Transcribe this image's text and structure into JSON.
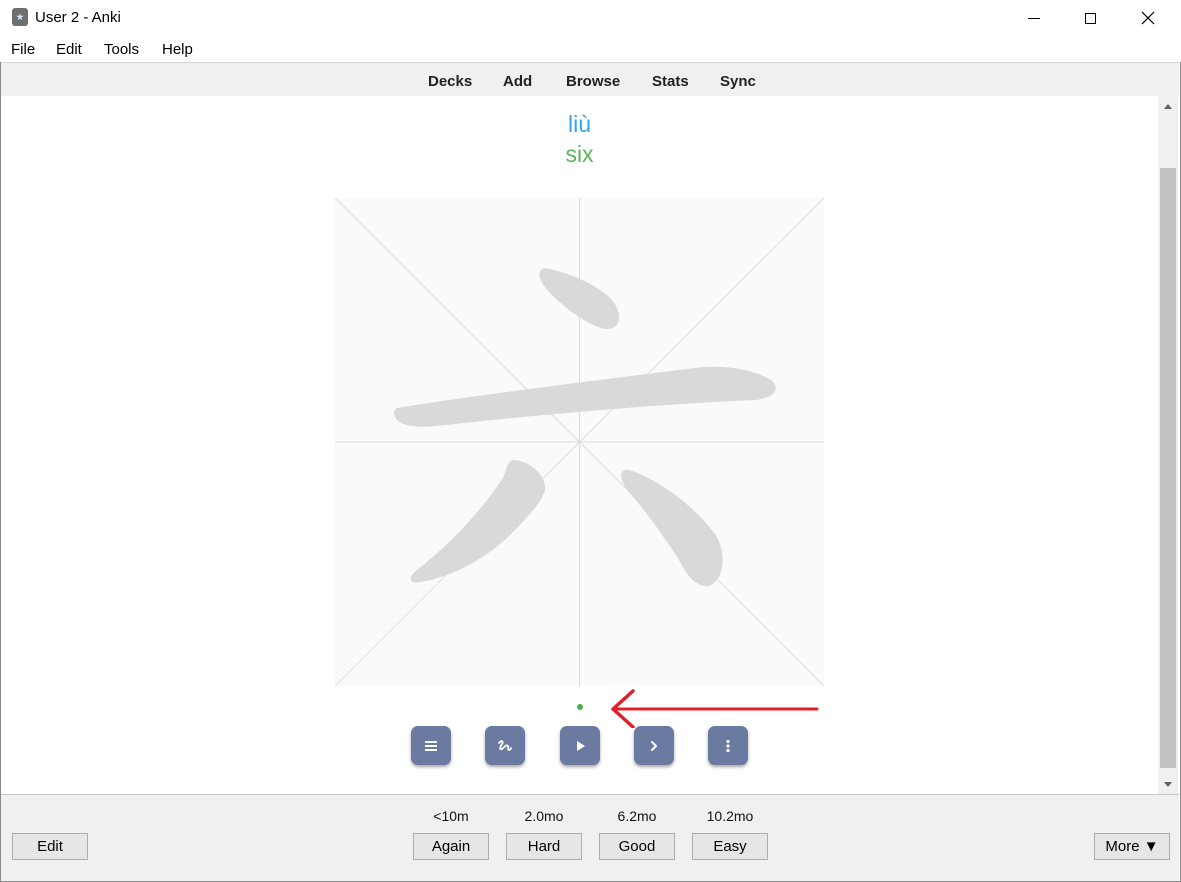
{
  "window": {
    "title": "User 2 - Anki"
  },
  "menu": [
    "File",
    "Edit",
    "Tools",
    "Help"
  ],
  "toolbar": [
    "Decks",
    "Add",
    "Browse",
    "Stats",
    "Sync"
  ],
  "card": {
    "pinyin": "liù",
    "meaning": "six",
    "character": "六",
    "pinyin_color": "#33a6e8",
    "meaning_color": "#5cb45c"
  },
  "controls": [
    {
      "icon": "menu-icon"
    },
    {
      "icon": "draw-icon"
    },
    {
      "icon": "play-icon"
    },
    {
      "icon": "next-icon"
    },
    {
      "icon": "more-vert-icon"
    }
  ],
  "answer": {
    "intervals": [
      "<10m",
      "2.0mo",
      "6.2mo",
      "10.2mo"
    ],
    "buttons": [
      "Again",
      "Hard",
      "Good",
      "Easy"
    ]
  },
  "bottom": {
    "edit_label": "Edit",
    "more_label": "More ▼"
  },
  "colors": {
    "accent_button": "#6b7aa1",
    "arrow": "#e0202a",
    "stroke": "#d9d9d9"
  }
}
